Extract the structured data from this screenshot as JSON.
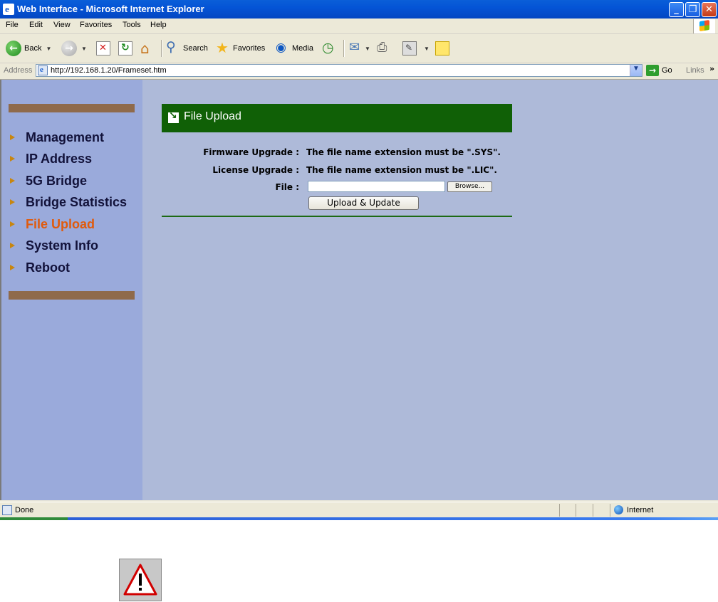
{
  "window": {
    "title": "Web Interface - Microsoft Internet Explorer",
    "buttons": {
      "minimize": "_",
      "maximize": "❐",
      "close": "✕"
    }
  },
  "menu": [
    "File",
    "Edit",
    "View",
    "Favorites",
    "Tools",
    "Help"
  ],
  "toolbar": {
    "back": "Back",
    "search": "Search",
    "favorites": "Favorites",
    "media": "Media"
  },
  "address": {
    "label": "Address",
    "url": "http://192.168.1.20/Frameset.htm",
    "go": "Go",
    "links": "Links",
    "more": "»"
  },
  "sidebar": {
    "items": [
      {
        "label": "Management",
        "active": false
      },
      {
        "label": "IP Address",
        "active": false
      },
      {
        "label": "5G Bridge",
        "active": false
      },
      {
        "label": "Bridge Statistics",
        "active": false
      },
      {
        "label": "File Upload",
        "active": true
      },
      {
        "label": "System Info",
        "active": false
      },
      {
        "label": "Reboot",
        "active": false
      }
    ]
  },
  "panel": {
    "title": "File Upload",
    "firmware_label": "Firmware Upgrade :",
    "firmware_value": "The file name extension must be \".SYS\".",
    "license_label": "License Upgrade :",
    "license_value": "The file name extension must be \".LIC\".",
    "file_label": "File :",
    "file_value": "",
    "browse": "Browse...",
    "upload": "Upload & Update"
  },
  "status": {
    "text": "Done",
    "zone": "Internet"
  },
  "colors": {
    "header_green": "#106006",
    "sidebar_bg": "#9aaadb",
    "content_bg": "#aebad9",
    "active_item": "#e05a0c",
    "divider_brown": "#8f6a4b"
  },
  "icons": {
    "warning": "warning-triangle-icon"
  }
}
